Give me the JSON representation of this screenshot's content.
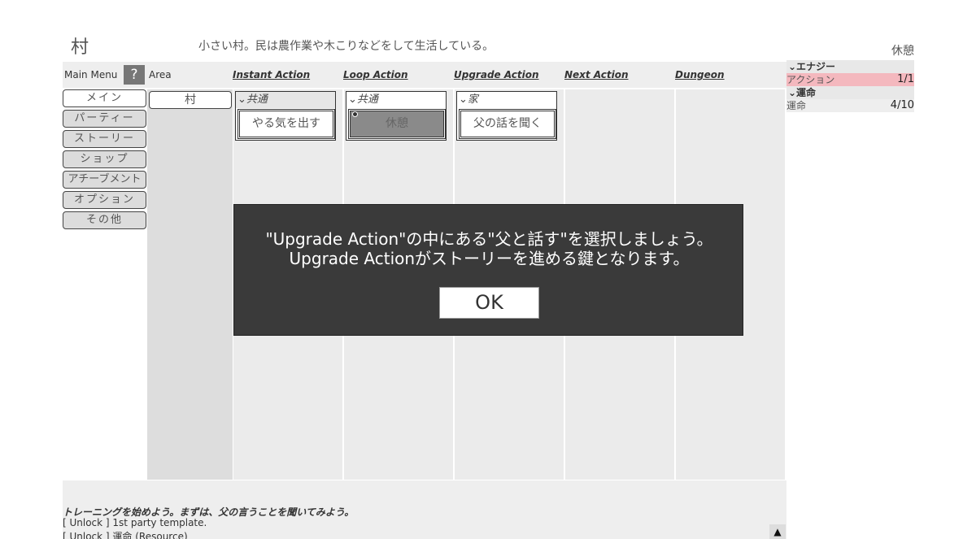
{
  "area": {
    "title": "村",
    "description": "小さい村。民は農作業や木こりなどをして生活している。",
    "status": "休憩"
  },
  "header": {
    "main_menu_label": "Main Menu",
    "help_label": "?",
    "area_label": "Area",
    "columns": [
      "Instant Action",
      "Loop Action",
      "Upgrade Action",
      "Next Action",
      "Dungeon"
    ]
  },
  "main_menu": {
    "items": [
      {
        "label": "メイン",
        "active": true
      },
      {
        "label": "パーティー"
      },
      {
        "label": "ストーリー"
      },
      {
        "label": "ショップ"
      },
      {
        "label": "アチーブメント"
      },
      {
        "label": "オプション"
      },
      {
        "label": "その他"
      }
    ]
  },
  "area_list": {
    "items": [
      "村"
    ]
  },
  "instant_action": {
    "group": "⌄共通",
    "button": "やる気を出す"
  },
  "loop_action": {
    "group": "⌄共通",
    "button": "休憩",
    "selected": true
  },
  "upgrade_action": {
    "group": "⌄家",
    "button": "父の話を聞く"
  },
  "resources": {
    "energy_header": "⌄エナジー",
    "action_label": "アクション",
    "action_value": "1/1",
    "fate_header": "⌄運命",
    "fate_label": "運命",
    "fate_value": "4/10"
  },
  "log": {
    "lines": [
      "トレーニングを始めよう。まずは、父の言うことを聞いてみよう。",
      "[ Unlock ] 1st party template.",
      "[ Unlock ] 運命 (Resource)"
    ],
    "scroll_up": "▲"
  },
  "modal": {
    "line1": "\"Upgrade Action\"の中にある\"父と話す\"を選択しましょう。",
    "line2": "Upgrade Actionがストーリーを進める鍵となります。",
    "ok": "OK"
  }
}
